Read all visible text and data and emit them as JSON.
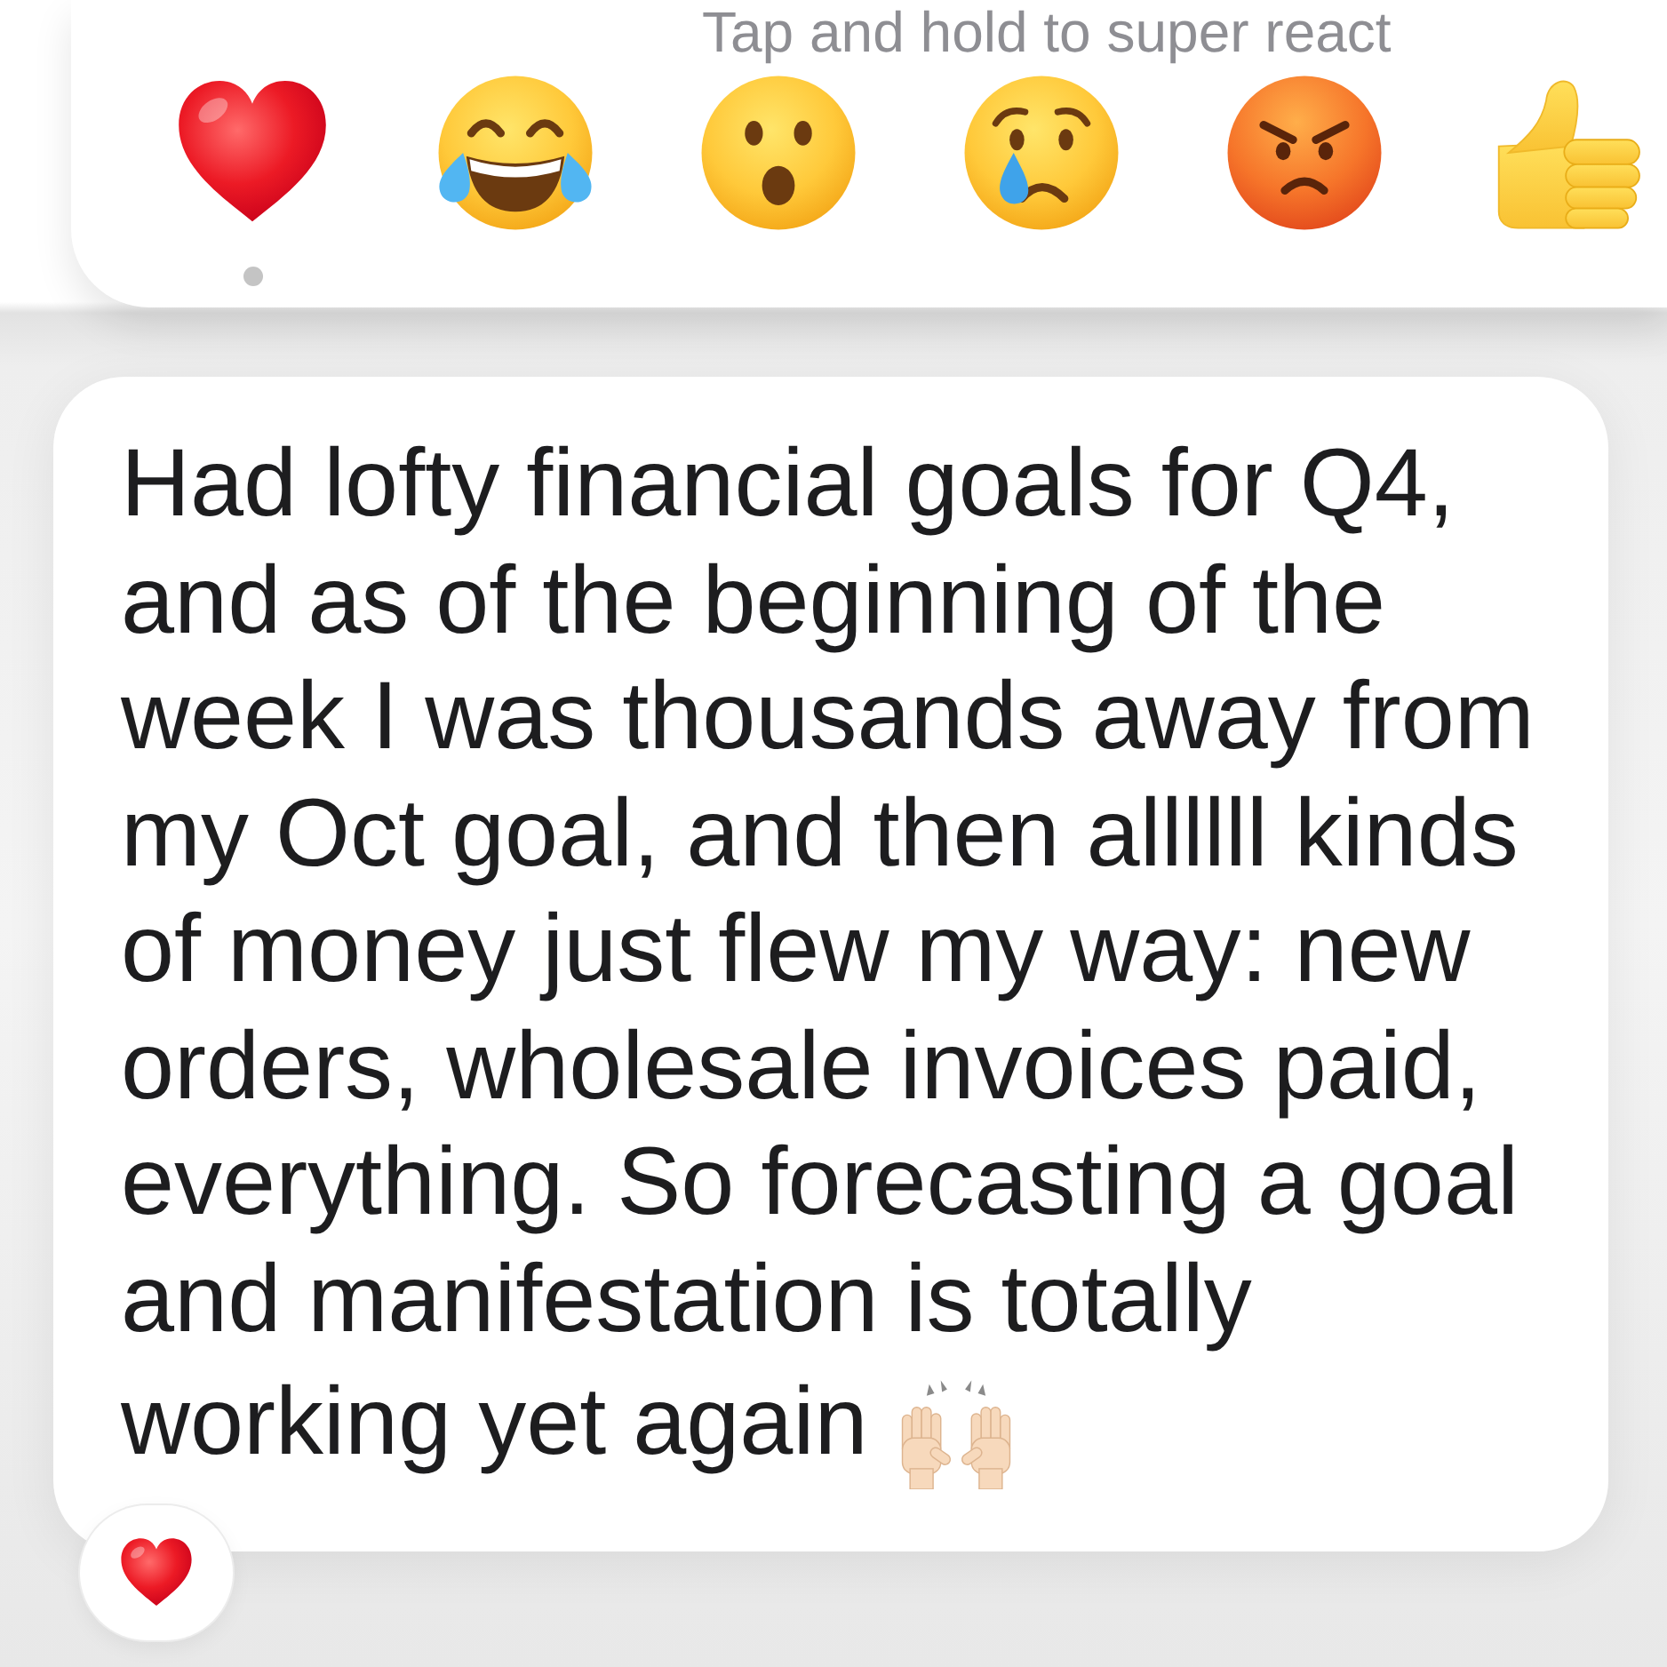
{
  "hint": "Tap and hold to super react",
  "reactions": [
    {
      "kind": "heart",
      "selected": true
    },
    {
      "kind": "laugh",
      "selected": false
    },
    {
      "kind": "wow",
      "selected": false
    },
    {
      "kind": "sad",
      "selected": false
    },
    {
      "kind": "angry",
      "selected": false
    },
    {
      "kind": "like",
      "selected": false
    }
  ],
  "message": {
    "lines": [
      "Had lofty financial goals for Q4,",
      "and as of the beginning of the",
      "week I was thousands away from",
      "my Oct goal, and then allllll kinds",
      "of money just flew my way: new",
      "orders, wholesale invoices paid,",
      "everything. So forecasting a goal",
      "and manifestation is totally",
      "working yet again"
    ],
    "reaction": {
      "kind": "heart"
    }
  }
}
